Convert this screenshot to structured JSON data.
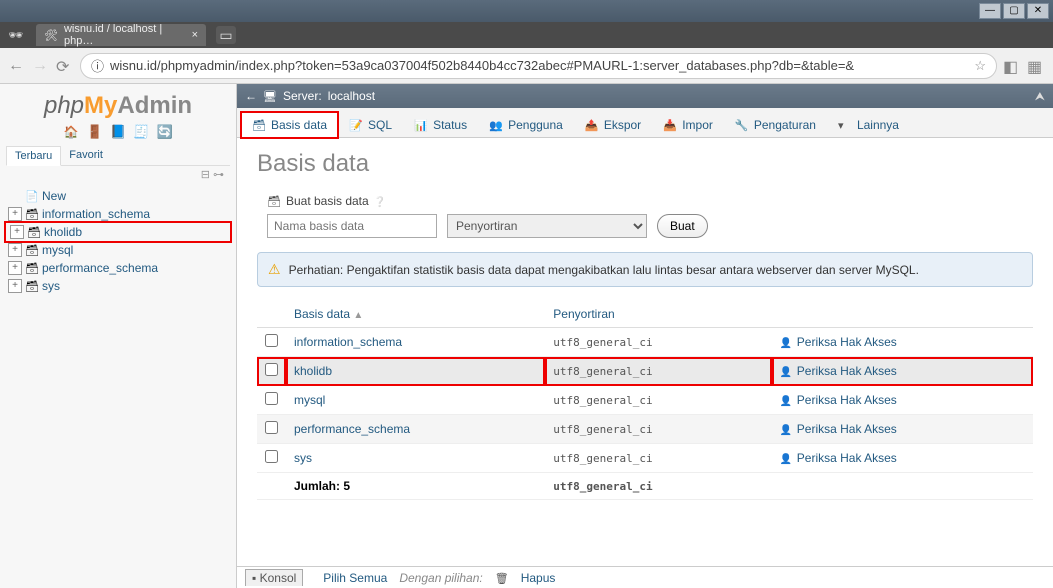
{
  "window": {
    "title": "wisnu.id / localhost | php…"
  },
  "url": "wisnu.id/phpmyadmin/index.php?token=53a9ca037004f502b8440b4cc732abec#PMAURL-1:server_databases.php?db=&table=&",
  "logo": {
    "php": "php",
    "my": "My",
    "admin": "Admin"
  },
  "history": {
    "recent": "Terbaru",
    "favorite": "Favorit"
  },
  "tree": {
    "new": "New",
    "items": [
      {
        "label": "information_schema"
      },
      {
        "label": "kholidb"
      },
      {
        "label": "mysql"
      },
      {
        "label": "performance_schema"
      },
      {
        "label": "sys"
      }
    ]
  },
  "breadcrumb": {
    "server_label": "Server:",
    "server_name": "localhost"
  },
  "tabs": {
    "basisdata": "Basis data",
    "sql": "SQL",
    "status": "Status",
    "pengguna": "Pengguna",
    "ekspor": "Ekspor",
    "impor": "Impor",
    "pengaturan": "Pengaturan",
    "lainnya": "Lainnya"
  },
  "page": {
    "heading": "Basis data",
    "create_label": "Buat basis data",
    "name_placeholder": "Nama basis data",
    "sort_placeholder": "Penyortiran",
    "create_button": "Buat"
  },
  "notice": "Perhatian: Pengaktifan statistik basis data dapat mengakibatkan lalu lintas besar antara webserver dan server MySQL.",
  "table": {
    "col_db": "Basis data",
    "col_sort": "Penyortiran",
    "priv_label": "Periksa Hak Akses",
    "rows": [
      {
        "name": "information_schema",
        "collation": "utf8_general_ci"
      },
      {
        "name": "kholidb",
        "collation": "utf8_general_ci"
      },
      {
        "name": "mysql",
        "collation": "utf8_general_ci"
      },
      {
        "name": "performance_schema",
        "collation": "utf8_general_ci"
      },
      {
        "name": "sys",
        "collation": "utf8_general_ci"
      }
    ],
    "sum_label": "Jumlah: 5",
    "sum_collation": "utf8_general_ci"
  },
  "footer": {
    "konsole": "Konsol",
    "select_all": "Pilih Semua",
    "with_selected": "Dengan pilihan:",
    "delete": "Hapus"
  }
}
